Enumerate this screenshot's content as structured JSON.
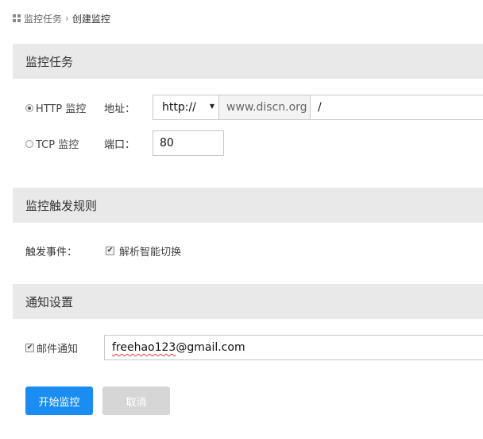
{
  "breadcrumb": {
    "home": "监控任务",
    "separator": "›",
    "current": "创建监控",
    "icon": "grid-icon"
  },
  "sections": {
    "task": "监控任务",
    "rules": "监控触发规则",
    "notify": "通知设置"
  },
  "task": {
    "http_option": "HTTP 监控",
    "tcp_option": "TCP 监控",
    "selected": "HTTP 监控",
    "address_label": "地址：",
    "protocol_value": "http://",
    "host_value": "www.discn.org",
    "path_value": "/",
    "port_label": "端口：",
    "port_value": "80"
  },
  "rules": {
    "event_label": "触发事件：",
    "event_option": "解析智能切换",
    "event_checked": true
  },
  "notify": {
    "email_option": "邮件通知",
    "email_checked": true,
    "email_prefix": "freehao123",
    "email_suffix": "@gmail.com"
  },
  "actions": {
    "start": "开始监控",
    "cancel": "取消"
  },
  "colors": {
    "primary": "#1b8df2",
    "section_bg": "#e9e9e9",
    "disabled": "#d6d6d6"
  }
}
